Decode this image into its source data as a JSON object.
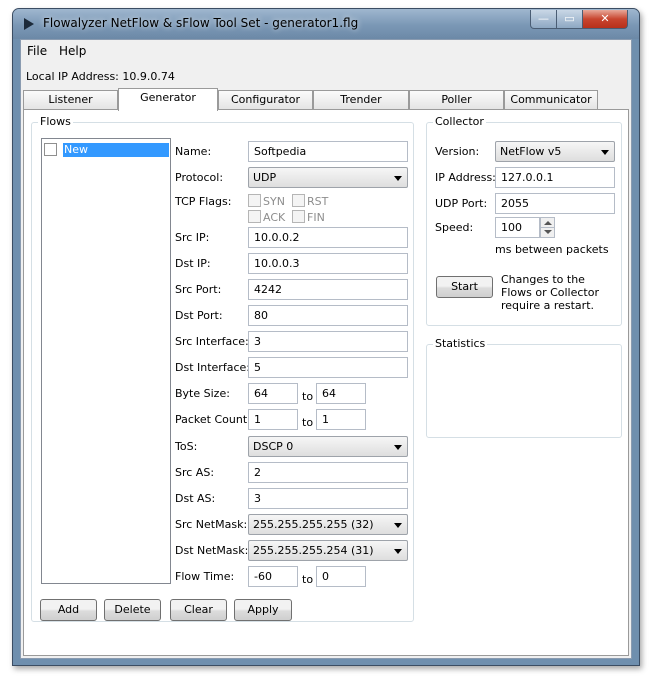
{
  "window": {
    "title": "Flowalyzer NetFlow & sFlow Tool Set - generator1.flg",
    "buttons": {
      "minimize": "—",
      "maximize": "▭",
      "close": "✕"
    }
  },
  "menu": {
    "file": "File",
    "help": "Help"
  },
  "local_ip": "Local IP Address: 10.9.0.74",
  "tabs": [
    "Listener",
    "Generator",
    "Configurator",
    "Trender",
    "Poller",
    "Communicator"
  ],
  "active_tab": "Generator",
  "flows": {
    "title": "Flows",
    "items": [
      {
        "label": "New",
        "selected": true
      }
    ],
    "buttons": {
      "add": "Add",
      "delete": "Delete",
      "clear": "Clear",
      "apply": "Apply"
    }
  },
  "form": {
    "name": {
      "label": "Name:",
      "value": "Softpedia"
    },
    "protocol": {
      "label": "Protocol:",
      "value": "UDP"
    },
    "tcp_flags": {
      "label": "TCP Flags:",
      "syn": "SYN",
      "rst": "RST",
      "ack": "ACK",
      "fin": "FIN"
    },
    "src_ip": {
      "label": "Src IP:",
      "value": "10.0.0.2"
    },
    "dst_ip": {
      "label": "Dst IP:",
      "value": "10.0.0.3"
    },
    "src_port": {
      "label": "Src Port:",
      "value": "4242"
    },
    "dst_port": {
      "label": "Dst Port:",
      "value": "80"
    },
    "src_interface": {
      "label": "Src Interface:",
      "value": "3"
    },
    "dst_interface": {
      "label": "Dst Interface:",
      "value": "5"
    },
    "byte_size": {
      "label": "Byte Size:",
      "from": "64",
      "to_label": "to",
      "to": "64"
    },
    "packet_count": {
      "label": "Packet Count:",
      "from": "1",
      "to_label": "to",
      "to": "1"
    },
    "tos": {
      "label": "ToS:",
      "value": "DSCP 0"
    },
    "src_as": {
      "label": "Src AS:",
      "value": "2"
    },
    "dst_as": {
      "label": "Dst AS:",
      "value": "3"
    },
    "src_netmask": {
      "label": "Src NetMask:",
      "value": "255.255.255.255 (32)"
    },
    "dst_netmask": {
      "label": "Dst NetMask:",
      "value": "255.255.255.254 (31)"
    },
    "flow_time": {
      "label": "Flow Time:",
      "from": "-60",
      "to_label": "to",
      "to": "0"
    }
  },
  "collector": {
    "title": "Collector",
    "version": {
      "label": "Version:",
      "value": "NetFlow v5"
    },
    "ip_address": {
      "label": "IP Address:",
      "value": "127.0.0.1"
    },
    "udp_port": {
      "label": "UDP Port:",
      "value": "2055"
    },
    "speed": {
      "label": "Speed:",
      "value": "100",
      "unit": "ms between packets"
    },
    "start_button": "Start",
    "restart_note": [
      "Changes to the",
      "Flows or Collector",
      "require a restart."
    ]
  },
  "statistics": {
    "title": "Statistics"
  },
  "colors": {
    "selection": "#3399ff",
    "titlebar": "#7a97b5",
    "close_button": "#c8452f"
  }
}
